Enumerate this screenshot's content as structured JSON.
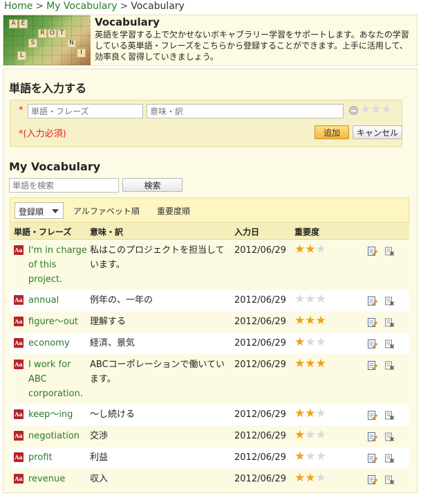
{
  "breadcrumb": {
    "home": "Home",
    "my_vocabulary": "My Vocabulary",
    "current": "Vocabulary",
    "separator": ">"
  },
  "hero": {
    "title": "Vocabulary",
    "description": "英語を学習する上で欠かせないボキャブラリー学習をサポートします。あなたの学習している英単語・フレーズをこちらから登録することができます。上手に活用して、効率良く習得していきましょう。"
  },
  "entry": {
    "heading": "単語を入力する",
    "required_mark": "*",
    "word_placeholder": "単語・フレーズ",
    "meaning_placeholder": "意味・訳",
    "required_note": "*(入力必須)",
    "add_label": "追加",
    "cancel_label": "キャンセル"
  },
  "vocab": {
    "heading": "My Vocabulary",
    "search_placeholder": "単語を検索",
    "search_label": "検索",
    "sort_select_value": "登録順",
    "sort_alpha": "アルファベット順",
    "sort_importance": "重要度順",
    "columns": {
      "word": "単語・フレーズ",
      "meaning": "意味・訳",
      "date": "入力日",
      "importance": "重要度"
    },
    "icons": {
      "word_badge": "Aa",
      "edit": "edit-icon",
      "delete": "delete-icon"
    },
    "colors": {
      "word_link": "#2a7a2a",
      "star_on": "#f0a21c",
      "star_off": "#d9d9d9",
      "badge": "#b3262b"
    },
    "rows": [
      {
        "word": "I'm in charge of this project.",
        "meaning": "私はこのプロジェクトを担当しています。",
        "date": "2012/06/29",
        "stars": 2
      },
      {
        "word": "annual",
        "meaning": "例年の、一年の",
        "date": "2012/06/29",
        "stars": 0
      },
      {
        "word": "figure～out",
        "meaning": "理解する",
        "date": "2012/06/29",
        "stars": 3
      },
      {
        "word": "economy",
        "meaning": "経済、景気",
        "date": "2012/06/29",
        "stars": 1
      },
      {
        "word": "I work for ABC corporation.",
        "meaning": "ABCコーポレーションで働いています。",
        "date": "2012/06/29",
        "stars": 3
      },
      {
        "word": "keep～ing",
        "meaning": "～し続ける",
        "date": "2012/06/29",
        "stars": 2
      },
      {
        "word": "negotiation",
        "meaning": "交渉",
        "date": "2012/06/29",
        "stars": 1
      },
      {
        "word": "profit",
        "meaning": "利益",
        "date": "2012/06/29",
        "stars": 1
      },
      {
        "word": "revenue",
        "meaning": "収入",
        "date": "2012/06/29",
        "stars": 2
      }
    ]
  }
}
